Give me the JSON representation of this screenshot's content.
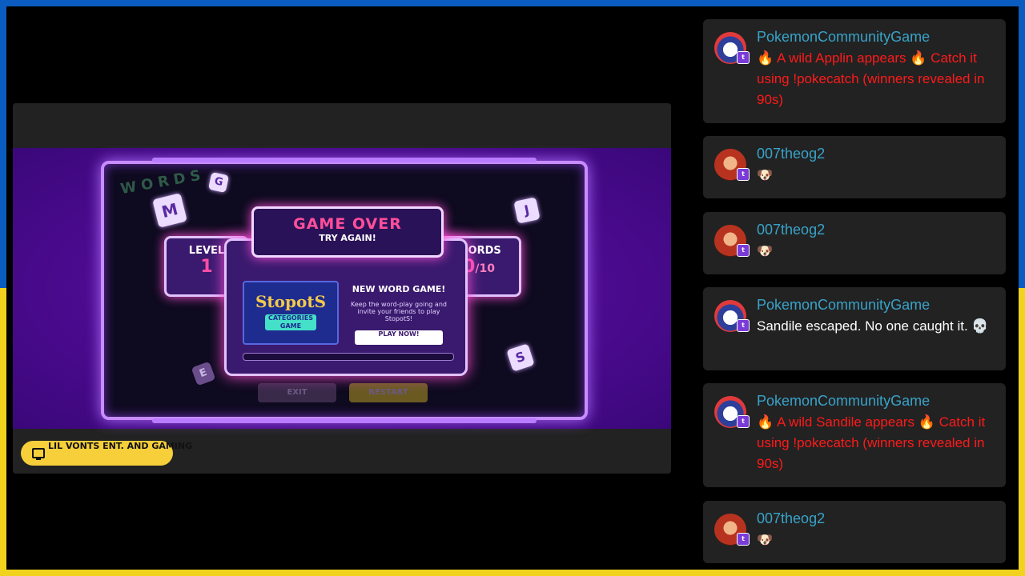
{
  "stream": {
    "game": {
      "logo_text": "WORDS",
      "dice": [
        "M",
        "G",
        "J",
        "S",
        "E"
      ],
      "buttons": {
        "exit": "EXIT",
        "restart": "RESTART"
      },
      "modal": {
        "title": "GAME OVER",
        "subtitle": "TRY AGAIN!",
        "level_label": "LEVEL",
        "level_value": "1",
        "words_label": "WORDS",
        "words_value": "0",
        "words_total": "/10",
        "promo_title": "NEW WORD GAME!",
        "promo_desc": "Keep the word-play going and invite your friends to play StopotS!",
        "promo_logo": "StopotS",
        "promo_tag": "CATEGORIES GAME",
        "play_button": "PLAY NOW!"
      }
    },
    "channel": "LIL VONTS ENT. AND GAMING"
  },
  "chat": {
    "messages": [
      {
        "user": "PokemonCommunityGame",
        "avatar": "pokemon-community-avatar",
        "text": "🔥 A wild Applin appears 🔥 Catch it using !pokecatch (winners revealed in 90s)",
        "color": "#ff1a1a"
      },
      {
        "user": "007theog2",
        "avatar": "007theog2-avatar",
        "text": "🐶",
        "color": "#ffffff"
      },
      {
        "user": "007theog2",
        "avatar": "007theog2-avatar",
        "text": "🐶",
        "color": "#ffffff"
      },
      {
        "user": "PokemonCommunityGame",
        "avatar": "pokemon-community-avatar",
        "text": "Sandile escaped. No one caught it. 💀",
        "color": "#ffffff"
      },
      {
        "user": "PokemonCommunityGame",
        "avatar": "pokemon-community-avatar",
        "text": "🔥 A wild Sandile appears 🔥 Catch it using !pokecatch (winners revealed in 90s)",
        "color": "#ff1a1a"
      },
      {
        "user": "007theog2",
        "avatar": "007theog2-avatar",
        "text": "🐶",
        "color": "#ffffff"
      }
    ]
  },
  "colors": {
    "flag_top": "#0b5cc0",
    "flag_bottom": "#f1d21c",
    "username": "#38a3c9",
    "alert_text": "#ff1a1a",
    "badge": "#f6cf3a"
  }
}
